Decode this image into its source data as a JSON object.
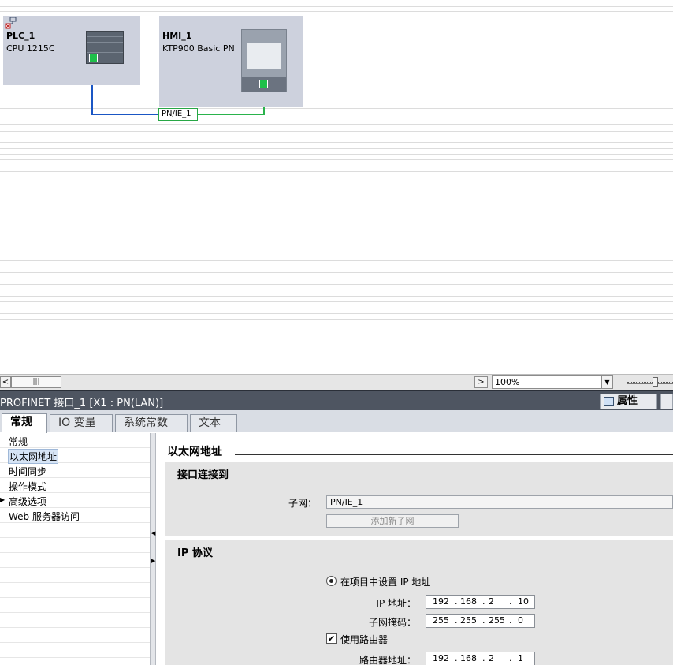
{
  "canvas": {
    "plc": {
      "name": "PLC_1",
      "type": "CPU 1215C"
    },
    "hmi": {
      "name": "HMI_1",
      "type": "KTP900 Basic PN"
    },
    "network": "PN/IE_1"
  },
  "scrollbar": {
    "zoom": "100%",
    "thumb_glyph": "|||",
    "left_arrow": "<",
    "right_arrow": ">",
    "dropdown_arrow": "▼"
  },
  "properties": {
    "title": "PROFINET 接口_1 [X1 : PN(LAN)]",
    "tab_label": "属性"
  },
  "tabs": [
    "常规",
    "IO 变量",
    "系统常数",
    "文本"
  ],
  "nav": {
    "items": [
      "常规",
      "以太网地址",
      "时间同步",
      "操作模式",
      "高级选项",
      "Web 服务器访问"
    ],
    "selected": 1
  },
  "content": {
    "section_title": "以太网地址",
    "interface_group": {
      "title": "接口连接到",
      "subnet_label": "子网：",
      "subnet_value": "PN/IE_1",
      "add_subnet": "添加新子网"
    },
    "ip_group": {
      "title": "IP 协议",
      "radio_label": "在项目中设置 IP 地址",
      "ip_label": "IP 地址：",
      "ip": [
        "192",
        "168",
        "2",
        "10"
      ],
      "mask_label": "子网掩码：",
      "mask": [
        "255",
        "255",
        "255",
        "0"
      ],
      "router_check_label": "使用路由器",
      "router_label": "路由器地址：",
      "router": [
        "192",
        "168",
        "2",
        "1"
      ]
    }
  }
}
